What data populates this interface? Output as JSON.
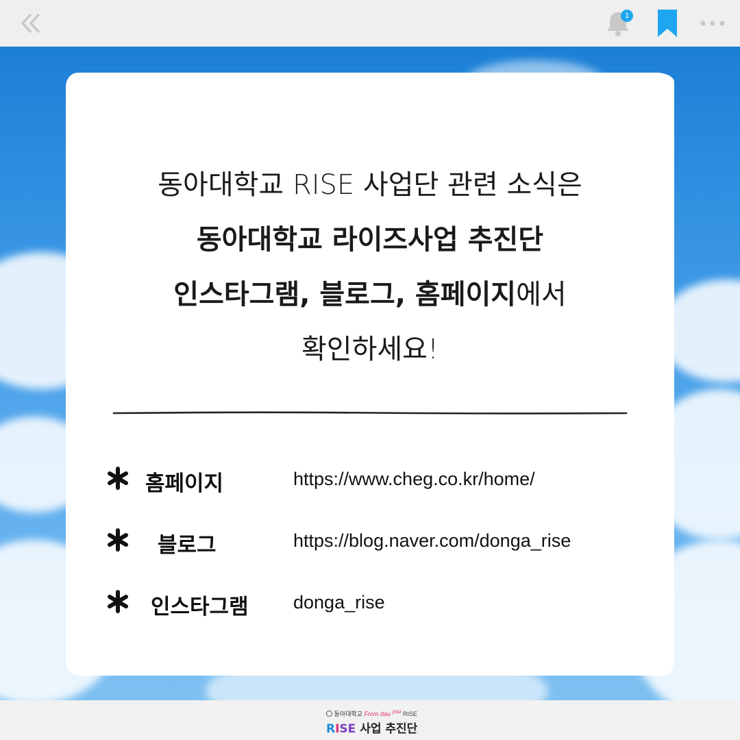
{
  "toolbar": {
    "back_icon": "double-chevron-left-icon",
    "bell_icon": "bell-icon",
    "notification_count": "1",
    "bookmark_icon": "bookmark-icon",
    "more_icon": "more-horizontal-icon",
    "icon_color": "#c8c8c8",
    "bookmark_color": "#1ea7f0"
  },
  "card": {
    "line1": "동아대학교 RISE 사업단 관련 소식은",
    "line2": "동아대학교 라이즈사업 추진단",
    "line3_bold": "인스타그램, 블로그, 홈페이지",
    "line3_rest": "에서",
    "line4": "확인하세요!",
    "links": [
      {
        "label": "홈페이지",
        "value": "https://www.cheg.co.kr/home/"
      },
      {
        "label": "블로그",
        "value": "https://blog.naver.com/donga_rise"
      },
      {
        "label": "인스타그램",
        "value": "donga_rise"
      }
    ]
  },
  "footer": {
    "university": "동아대학교",
    "slogan_from": "From dau",
    "slogan_you": "you",
    "slogan_rise": "RISE",
    "brand_r": "R",
    "brand_i": "I",
    "brand_se": "SE",
    "brand_rest": "사업 추진단"
  }
}
